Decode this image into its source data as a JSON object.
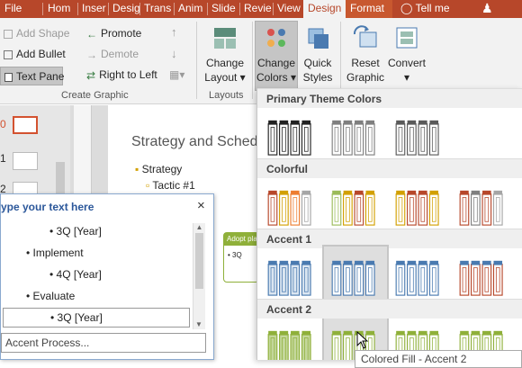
{
  "ribbon_tabs": [
    "File",
    "Hom",
    "Inser",
    "Desig",
    "Trans",
    "Anim",
    "Slide",
    "Revie",
    "View",
    "Design",
    "Format"
  ],
  "tell_me": "Tell me",
  "create_graphic": {
    "add_shape": "Add Shape",
    "add_bullet": "Add Bullet",
    "text_pane": "Text Pane",
    "promote": "Promote",
    "demote": "Demote",
    "right_to_left": "Right to Left",
    "group_label": "Create Graphic"
  },
  "layouts": {
    "change_layout_line1": "Change",
    "change_layout_line2": "Layout",
    "group_label": "Layouts"
  },
  "smartart_styles": {
    "change_colors_line1": "Change",
    "change_colors_line2": "Colors",
    "quick_styles_line1": "Quick",
    "quick_styles_line2": "Styles"
  },
  "reset": {
    "reset_line1": "Reset",
    "reset_line2": "Graphic",
    "convert": "Convert"
  },
  "slide_numbers": [
    "0",
    "1",
    "2"
  ],
  "slide": {
    "title": "Strategy and Sched",
    "bullet": "Strategy",
    "sub_bullet": "Tactic #1",
    "shape_label": "Adopt pla",
    "shape_item": "3Q"
  },
  "text_pane": {
    "title": "ype your text here",
    "items": [
      {
        "text": "3Q [Year]",
        "level": 2
      },
      {
        "text": "Implement",
        "level": 1
      },
      {
        "text": "4Q [Year]",
        "level": 2
      },
      {
        "text": "Evaluate",
        "level": 1
      },
      {
        "text": "3Q [Year]",
        "level": 2
      }
    ],
    "footer": "Accent Process..."
  },
  "colors_gallery": {
    "sections": [
      {
        "title": "Primary Theme Colors",
        "options": [
          {
            "fill": "#ffffff",
            "stroke": "#222222",
            "bar": "#222222"
          },
          {
            "fill": "#ffffff",
            "stroke": "#7f7f7f",
            "bar": "#7f7f7f"
          },
          {
            "fill": "#ffffff",
            "stroke": "#5a5a5a",
            "bar": "#5a5a5a"
          }
        ]
      },
      {
        "title": "Colorful",
        "options": [
          {
            "fill": "#ffffff",
            "stroke": "#a5a5a5",
            "bars": [
              "#b7472a",
              "#d2a000",
              "#ed7d31",
              "#a5a5a5"
            ]
          },
          {
            "fill": "#ffffff",
            "stroke": "#a5a5a5",
            "bars": [
              "#9bbb59",
              "#d2a000",
              "#b7472a",
              "#d2a000"
            ]
          },
          {
            "fill": "#ffffff",
            "stroke": "#a5a5a5",
            "bars": [
              "#d2a000",
              "#b7472a",
              "#b7472a",
              "#d2a000"
            ]
          },
          {
            "fill": "#ffffff",
            "stroke": "#a5a5a5",
            "bars": [
              "#b7472a",
              "#7f7f7f",
              "#b7472a",
              "#a5a5a5"
            ]
          }
        ]
      },
      {
        "title": "Accent 1",
        "options": [
          {
            "fill": "#dbe6f1",
            "stroke": "#4a7ab0",
            "bar": "#4a7ab0"
          },
          {
            "fill": "#ffffff",
            "stroke": "#4a7ab0",
            "bar": "#4a7ab0"
          },
          {
            "fill": "#ffffff",
            "stroke": "#4a7ab0",
            "bar": "#4a7ab0"
          },
          {
            "fill": "#ffffff",
            "stroke": "#b7472a",
            "bar": "#4a7ab0"
          }
        ]
      },
      {
        "title": "Accent 2",
        "options": [
          {
            "fill": "#c4d79b",
            "stroke": "#8fb03a",
            "bar": "#8fb03a"
          },
          {
            "fill": "#ffffff",
            "stroke": "#8fb03a",
            "bar": "#8fb03a"
          },
          {
            "fill": "#ffffff",
            "stroke": "#8fb03a",
            "bar": "#8fb03a"
          },
          {
            "fill": "#ffffff",
            "stroke": "#8fb03a",
            "bar": "#8fb03a"
          }
        ]
      }
    ],
    "tooltip": "Colored Fill - Accent 2"
  },
  "colors": {
    "tab_red": "#b7472a",
    "accent_blue": "#4a7ab0",
    "accent_green": "#8fb03a"
  }
}
